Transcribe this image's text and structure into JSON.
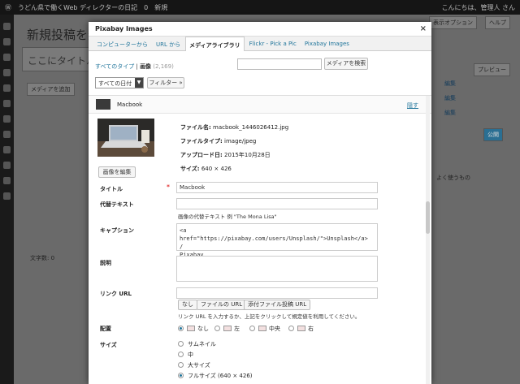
{
  "adminbar": {
    "site": "うどん県で働くWeb ディレクターの日記",
    "comments": "0",
    "new": "新規",
    "greeting": "こんにちは、管理人 さん"
  },
  "background": {
    "title": "新規投稿を追加",
    "title_placeholder": "ここにタイトルを",
    "add_media": "メディアを追加",
    "screen_options": "表示オプション",
    "help": "ヘルプ",
    "preview": "プレビュー",
    "publish": "公開",
    "word_count": "文字数: 0",
    "side_edit": "編集",
    "side_often": "よく使うもの"
  },
  "modal": {
    "title": "Pixabay Images",
    "close": "×",
    "tabs": [
      "コンピューターから",
      "URL から",
      "メディアライブラリ",
      "Flickr - Pick a Pic",
      "Pixabay Images"
    ],
    "active_tab": "メディアライブラリ",
    "filter": {
      "all_types": "すべてのタイプ",
      "separator": "|",
      "images": "画像",
      "count": "(2,169)"
    },
    "search_button": "メディアを検索",
    "date_select": "すべての日付",
    "filter_button": "フィルター »",
    "item": {
      "name": "Macbook",
      "hide": "隠す"
    },
    "meta": {
      "filename_label": "ファイル名:",
      "filename": "macbook_1446026412.jpg",
      "filetype_label": "ファイルタイプ:",
      "filetype": "image/jpeg",
      "upload_label": "アップロード日:",
      "upload": "2015年10月28日",
      "size_label": "サイズ:",
      "size": "640 × 426"
    },
    "edit_image": "画像を編集",
    "fields": {
      "title_label": "タイトル",
      "title_required": "*",
      "title_value": "Macbook",
      "alt_label": "代替テキスト",
      "alt_help": "画像の代替テキスト 例 \"The Mona Lisa\"",
      "caption_label": "キャプション",
      "caption_line1": "<a href=\"https://pixabay.com/users/Unsplash/\">Unsplash</a> /",
      "caption_line2": "Pixabay",
      "desc_label": "説明",
      "link_label": "リンク URL",
      "link_none": "なし",
      "link_file": "ファイルの URL",
      "link_post": "添付ファイル投稿 URL",
      "link_help": "リンク URL を入力するか、上記をクリックして規定値を利用してください。",
      "align_label": "配置",
      "align_options": [
        "なし",
        "左",
        "中央",
        "右"
      ],
      "size_label": "サイズ",
      "size_options": [
        "サムネイル",
        "中",
        "大サイズ",
        "フルサイズ (640 × 426)"
      ]
    }
  }
}
